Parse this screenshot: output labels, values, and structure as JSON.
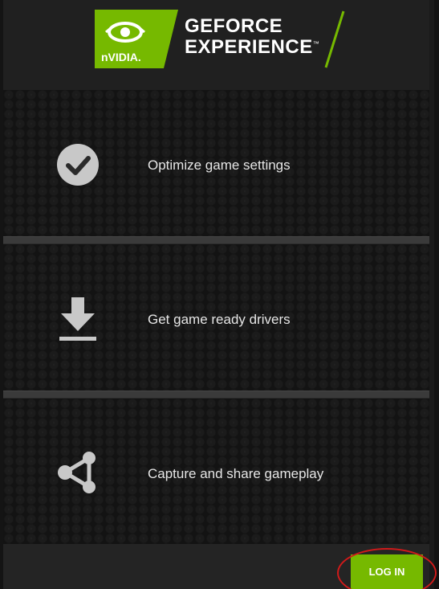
{
  "header": {
    "brand_badge_text": "nVIDIA.",
    "product_line1": "GEFORCE",
    "product_line2": "EXPERIENCE",
    "trademark": "™"
  },
  "features": [
    {
      "label": "Optimize game settings",
      "icon": "checkmark-circle-icon"
    },
    {
      "label": "Get game ready drivers",
      "icon": "download-icon"
    },
    {
      "label": "Capture and share gameplay",
      "icon": "share-icon"
    }
  ],
  "footer": {
    "login_label": "LOG IN"
  },
  "colors": {
    "brand_green": "#76b900",
    "annotation_red": "#d11a1a",
    "icon_gray": "#c8c8c8"
  }
}
